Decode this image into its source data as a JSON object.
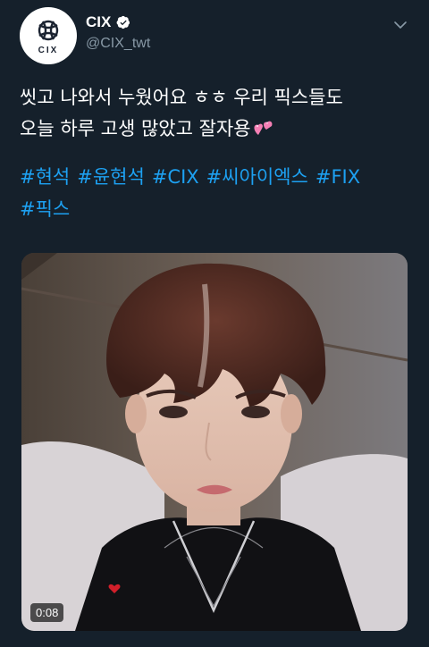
{
  "account": {
    "display_name": "CIX",
    "handle": "@CIX_twt",
    "verified": true,
    "avatar_text": "CIX"
  },
  "tweet": {
    "text_line1": "씻고 나와서 누웠어요 ㅎㅎ 우리 픽스들도",
    "text_line2": "오늘 하루 고생 많았고 잘자용",
    "emoji": "two-hearts-emoji",
    "hashtags": [
      "#현석",
      "#윤현석",
      "#CIX",
      "#씨아이엑스",
      "#FIX",
      "#픽스"
    ]
  },
  "media": {
    "type": "video",
    "duration": "0:08"
  },
  "colors": {
    "background": "#15202b",
    "link": "#1da1f2",
    "secondary_text": "#8899a6",
    "verified_badge": "#ffffff"
  }
}
